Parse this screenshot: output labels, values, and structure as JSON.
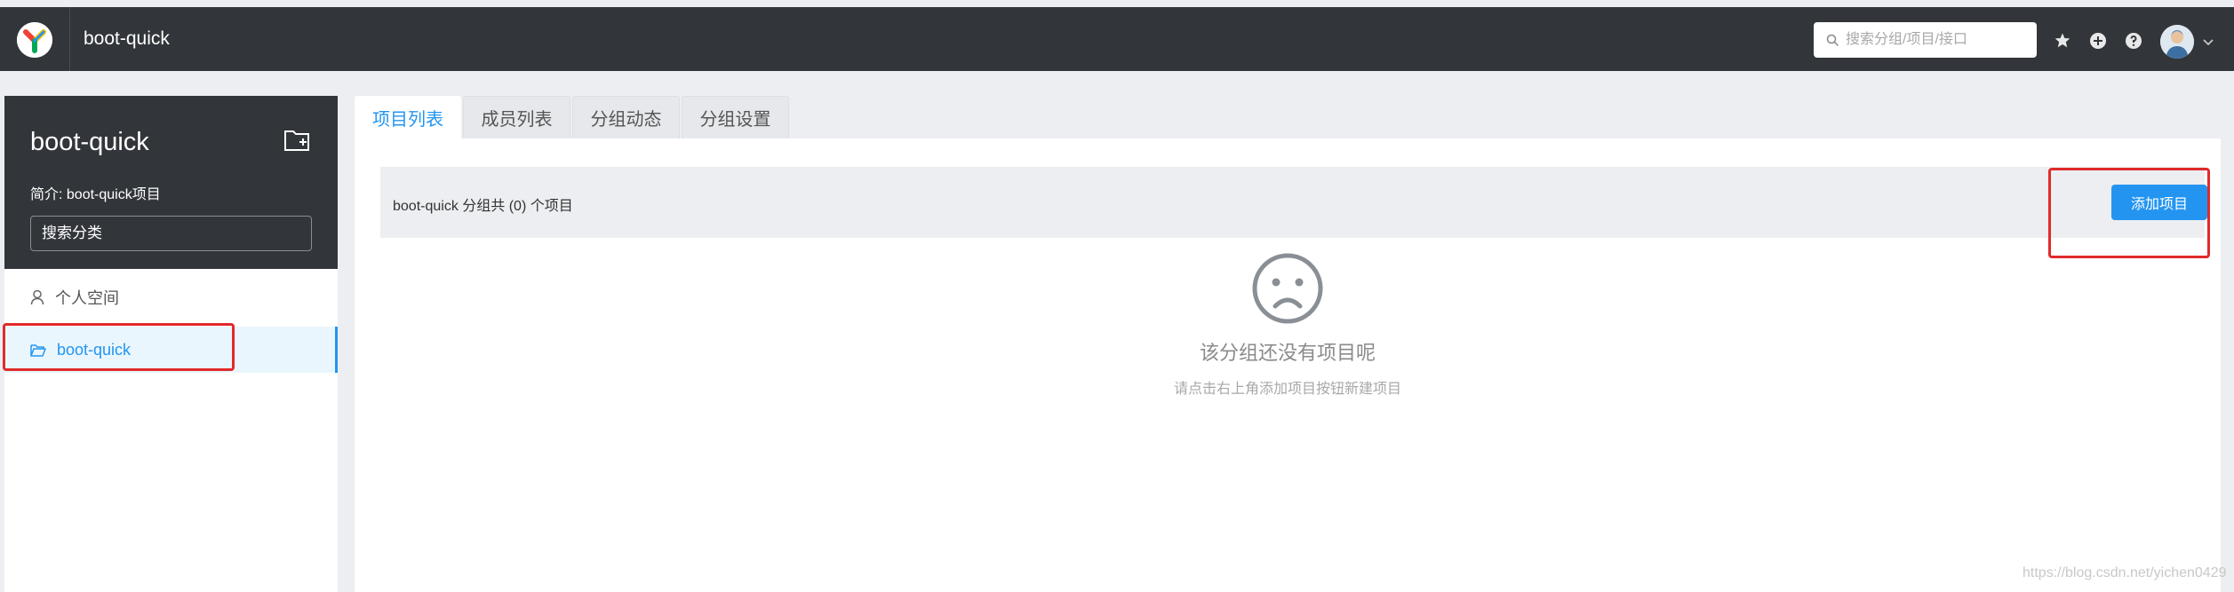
{
  "header": {
    "app_title": "boot-quick",
    "search_placeholder": "搜索分组/项目/接口"
  },
  "sidebar": {
    "group_name": "boot-quick",
    "description": "简介: boot-quick项目",
    "category_search_placeholder": "搜索分类",
    "items": [
      {
        "label": "个人空间",
        "icon": "user-icon",
        "active": false
      },
      {
        "label": "boot-quick",
        "icon": "folder-open-icon",
        "active": true
      }
    ]
  },
  "tabs": [
    {
      "label": "项目列表",
      "active": true
    },
    {
      "label": "成员列表",
      "active": false
    },
    {
      "label": "分组动态",
      "active": false
    },
    {
      "label": "分组设置",
      "active": false
    }
  ],
  "main": {
    "summary": "boot-quick 分组共 (0) 个项目",
    "add_button": "添加项目",
    "empty_title": "该分组还没有项目呢",
    "empty_desc": "请点击右上角添加项目按钮新建项目"
  },
  "watermark": "https://blog.csdn.net/yichen0429",
  "colors": {
    "header_bg": "#32363a",
    "accent": "#2395f1",
    "annotation": "#e02a2a"
  }
}
